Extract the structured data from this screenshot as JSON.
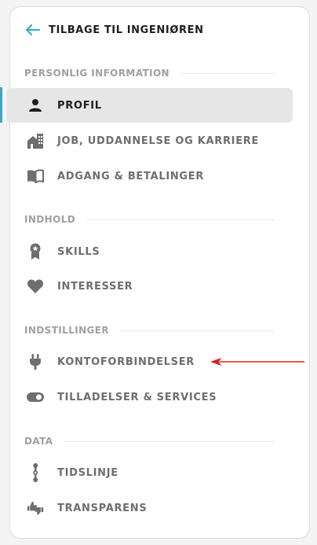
{
  "back": {
    "label": "TILBAGE TIL INGENIØREN",
    "icon": "arrow-left-icon"
  },
  "colors": {
    "accent": "#3aa6c9",
    "annotation": "#e02020",
    "icon": "#6e6e6e",
    "active_bg": "#e6e6e6"
  },
  "sections": {
    "personal": {
      "title": "PERSONLIG INFORMATION",
      "items": [
        {
          "label": "PROFIL",
          "icon": "person-icon",
          "active": true
        },
        {
          "label": "JOB, UDDANNELSE OG KARRIERE",
          "icon": "buildings-icon"
        },
        {
          "label": "ADGANG & BETALINGER",
          "icon": "book-icon"
        }
      ]
    },
    "content": {
      "title": "INDHOLD",
      "items": [
        {
          "label": "SKILLS",
          "icon": "award-icon"
        },
        {
          "label": "INTERESSER",
          "icon": "heart-icon"
        }
      ]
    },
    "settings": {
      "title": "INDSTILLINGER",
      "items": [
        {
          "label": "KONTOFORBINDELSER",
          "icon": "plug-icon"
        },
        {
          "label": "TILLADELSER & SERVICES",
          "icon": "toggle-icon"
        }
      ]
    },
    "data": {
      "title": "DATA",
      "items": [
        {
          "label": "TIDSLINJE",
          "icon": "timeline-icon"
        },
        {
          "label": "TRANSPARENS",
          "icon": "thumbs-icon"
        }
      ]
    }
  }
}
